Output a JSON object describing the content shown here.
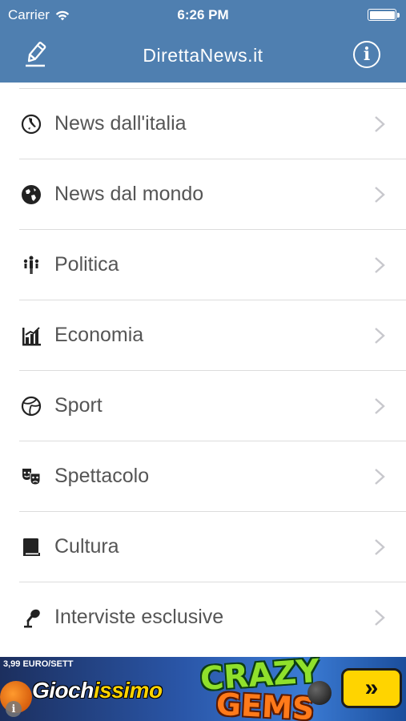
{
  "status_bar": {
    "carrier": "Carrier",
    "time": "6:26 PM"
  },
  "nav": {
    "title": "DirettaNews.it",
    "edit_icon": "pencil-icon",
    "info_icon": "info-icon",
    "info_glyph": "i"
  },
  "categories": [
    {
      "label": "News dall'italia",
      "icon": "italy-map-icon"
    },
    {
      "label": "News dal mondo",
      "icon": "globe-icon"
    },
    {
      "label": "Politica",
      "icon": "politics-figures-icon"
    },
    {
      "label": "Economia",
      "icon": "economy-chart-icon"
    },
    {
      "label": "Sport",
      "icon": "ball-icon"
    },
    {
      "label": "Spettacolo",
      "icon": "theater-masks-icon"
    },
    {
      "label": "Cultura",
      "icon": "book-icon"
    },
    {
      "label": "Interviste esclusive",
      "icon": "microphone-icon"
    }
  ],
  "ad": {
    "price": "3,99 EURO/SETT",
    "brand_prefix": "Gioch",
    "brand_highlight": "issimo",
    "game_line1": "CRAZY",
    "game_line2": "GEMS",
    "cta": "»",
    "info": "i"
  },
  "colors": {
    "header": "#4f7fb0",
    "label_text": "#555555",
    "separator": "#dcdcdc",
    "chevron": "#c8c8cd"
  }
}
